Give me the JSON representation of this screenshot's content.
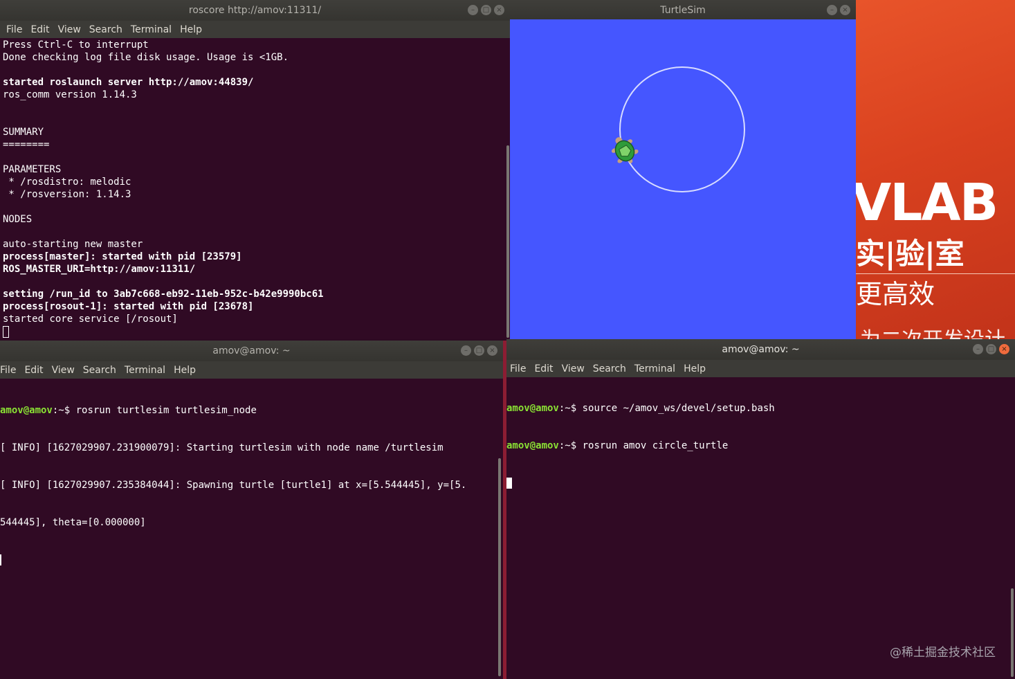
{
  "wallpaper": {
    "brand_text": "VLAB",
    "line1": "实|验|室",
    "line2": "更高效",
    "line3": "为二次开发设计"
  },
  "windows": {
    "roscore": {
      "title": "roscore http://amov:11311/",
      "menu": [
        "File",
        "Edit",
        "View",
        "Search",
        "Terminal",
        "Help"
      ],
      "lines": [
        {
          "text": "Press Ctrl-C to interrupt",
          "bold": false
        },
        {
          "text": "Done checking log file disk usage. Usage is <1GB.",
          "bold": false
        },
        {
          "text": "",
          "bold": false
        },
        {
          "text": "started roslaunch server http://amov:44839/",
          "bold": true
        },
        {
          "text": "ros_comm version 1.14.3",
          "bold": false
        },
        {
          "text": "",
          "bold": false
        },
        {
          "text": "",
          "bold": false
        },
        {
          "text": "SUMMARY",
          "bold": false
        },
        {
          "text": "========",
          "bold": false
        },
        {
          "text": "",
          "bold": false
        },
        {
          "text": "PARAMETERS",
          "bold": false
        },
        {
          "text": " * /rosdistro: melodic",
          "bold": false
        },
        {
          "text": " * /rosversion: 1.14.3",
          "bold": false
        },
        {
          "text": "",
          "bold": false
        },
        {
          "text": "NODES",
          "bold": false
        },
        {
          "text": "",
          "bold": false
        },
        {
          "text": "auto-starting new master",
          "bold": false
        },
        {
          "text": "process[master]: started with pid [23579]",
          "bold": true
        },
        {
          "text": "ROS_MASTER_URI=http://amov:11311/",
          "bold": true
        },
        {
          "text": "",
          "bold": false
        },
        {
          "text": "setting /run_id to 3ab7c668-eb92-11eb-952c-b42e9990bc61",
          "bold": true
        },
        {
          "text": "process[rosout-1]: started with pid [23678]",
          "bold": true
        },
        {
          "text": "started core service [/rosout]",
          "bold": false
        }
      ]
    },
    "turtlesim": {
      "title": "TurtleSim",
      "background_color": "#4556ff",
      "path_color": "#d8dcff"
    },
    "node": {
      "title": "amov@amov: ~",
      "menu": [
        "File",
        "Edit",
        "View",
        "Search",
        "Terminal",
        "Help"
      ],
      "prompt_user": "amov@amov",
      "prompt_path": ":~$",
      "command": " rosrun turtlesim turtlesim_node",
      "lines": [
        "[ INFO] [1627029907.231900079]: Starting turtlesim with node name /turtlesim",
        "[ INFO] [1627029907.235384044]: Spawning turtle [turtle1] at x=[5.544445], y=[5.",
        "544445], theta=[0.000000]"
      ]
    },
    "circle": {
      "title": "amov@amov: ~",
      "menu": [
        "File",
        "Edit",
        "View",
        "Search",
        "Terminal",
        "Help"
      ],
      "prompt_user": "amov@amov",
      "prompt_path": ":~$",
      "command1": " source ~/amov_ws/devel/setup.bash",
      "command2": " rosrun amov circle_turtle"
    }
  },
  "watermark": "@稀土掘金技术社区",
  "colors": {
    "terminal_bg": "#300a24",
    "prompt_user": "#8ae234",
    "prompt_path": "#729fcf",
    "titlebar": "#3c3b37",
    "wallpaper_orange": "#e05a2a"
  }
}
